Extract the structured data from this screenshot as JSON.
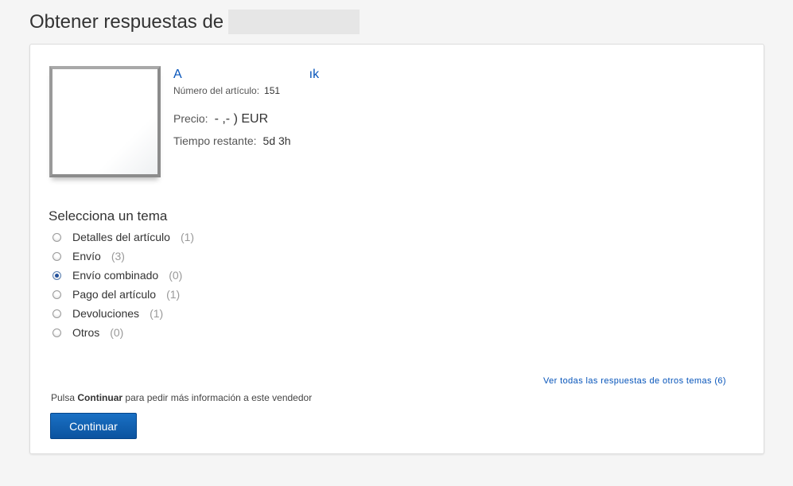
{
  "header": {
    "title": "Obtener respuestas de"
  },
  "item": {
    "title_start": "A",
    "title_end": "ık",
    "number_label": "Número del artículo:",
    "number_value": "151",
    "price_label": "Precio:",
    "price_value": "- ,- ) EUR",
    "time_label": "Tiempo restante:",
    "time_value": "5d 3h"
  },
  "topics": {
    "heading": "Selecciona un tema",
    "items": [
      {
        "label": "Detalles del artículo",
        "count": "(1)",
        "selected": false
      },
      {
        "label": "Envío",
        "count": "(3)",
        "selected": false
      },
      {
        "label": "Envío combinado",
        "count": "(0)",
        "selected": true
      },
      {
        "label": "Pago del artículo",
        "count": "(1)",
        "selected": false
      },
      {
        "label": "Devoluciones",
        "count": "(1)",
        "selected": false
      },
      {
        "label": "Otros",
        "count": "(0)",
        "selected": false
      }
    ]
  },
  "footer": {
    "all_answers_link": "Ver todas las respuestas de otros temas (6)",
    "instruction_prefix": "Pulsa",
    "instruction_bold": "Continuar",
    "instruction_suffix": "para pedir más información a este vendedor",
    "continue_label": "Continuar"
  },
  "colors": {
    "link": "#0654ba",
    "button": "#0b539f",
    "background": "#f5f5f5"
  }
}
